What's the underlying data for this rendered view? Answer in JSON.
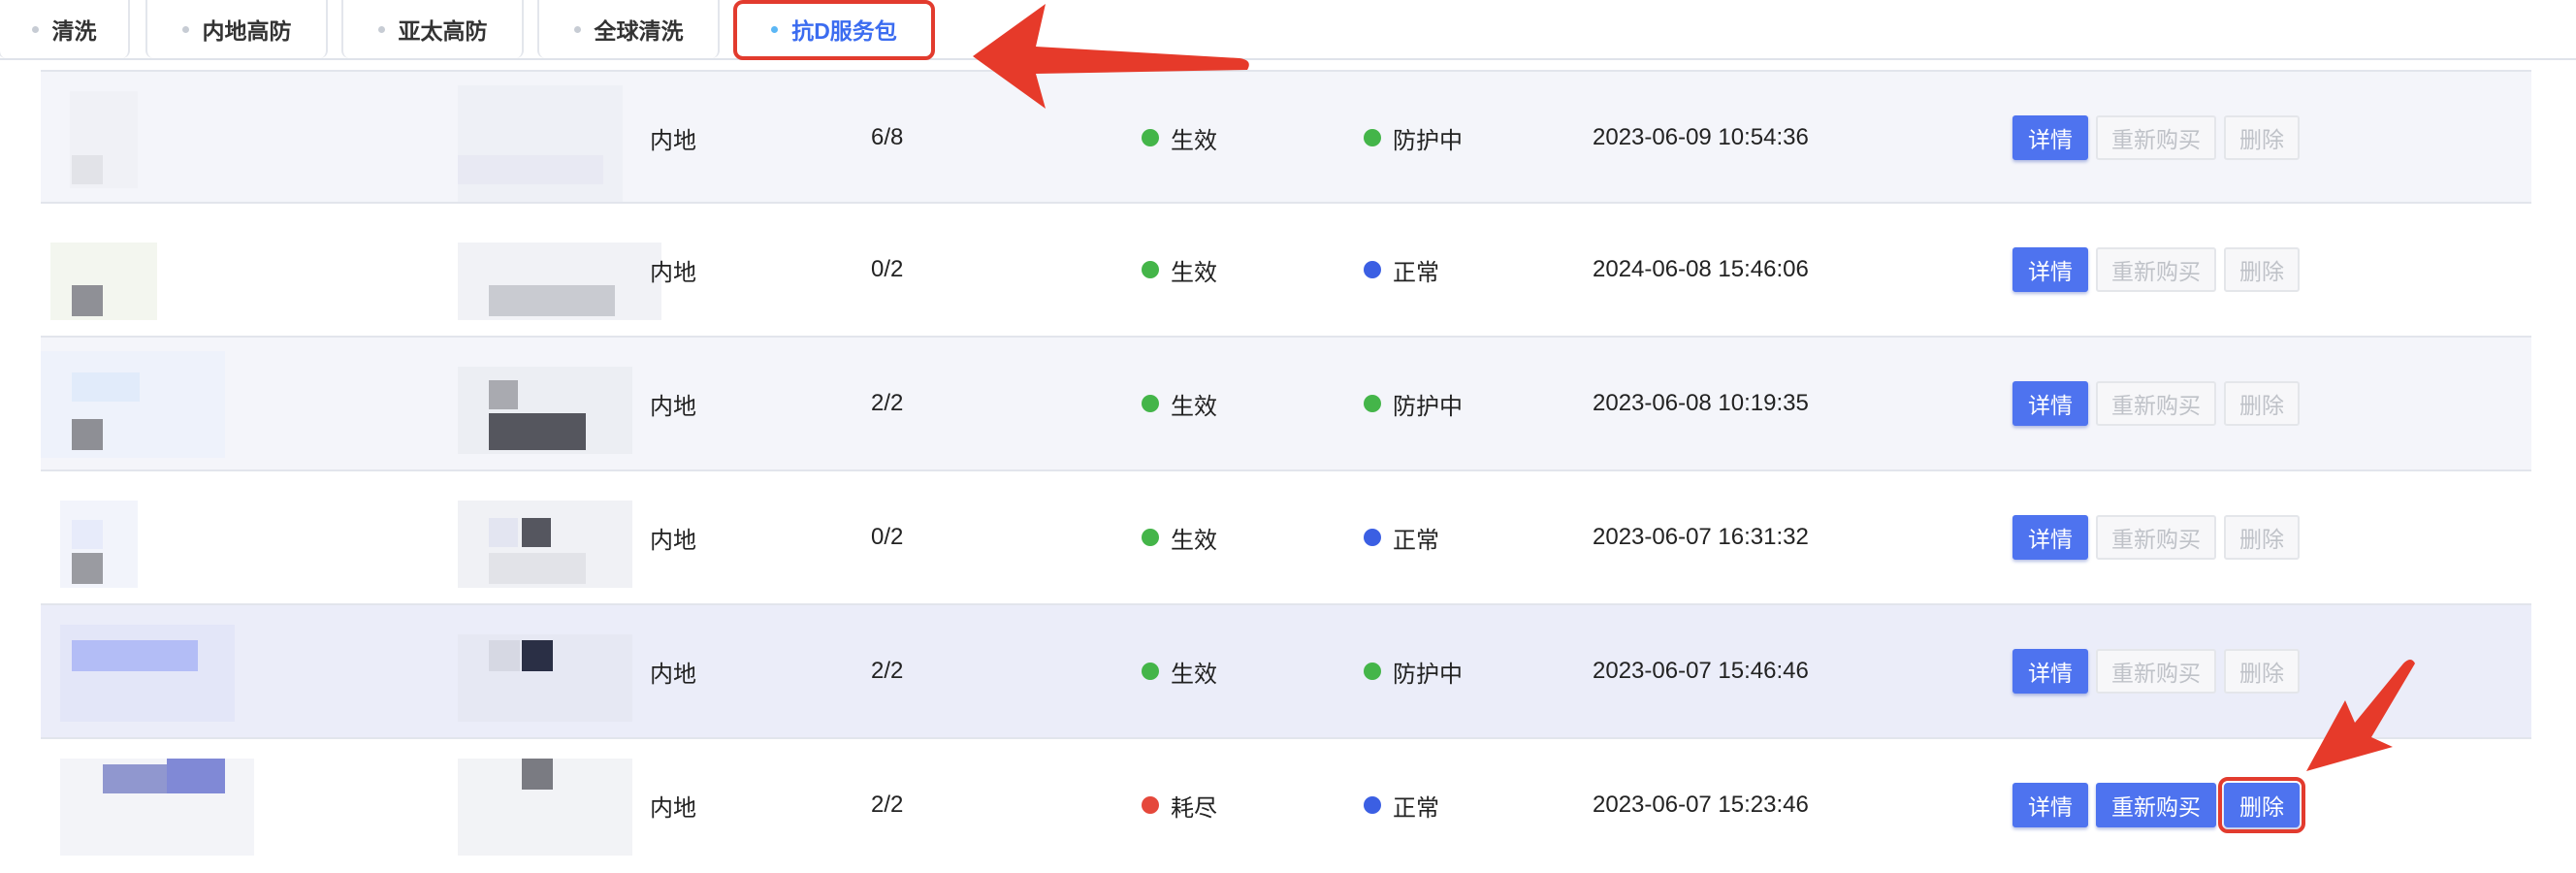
{
  "tabs": [
    {
      "label": "清洗",
      "active": false
    },
    {
      "label": "内地高防",
      "active": false
    },
    {
      "label": "亚太高防",
      "active": false
    },
    {
      "label": "全球清洗",
      "active": false
    },
    {
      "label": "抗D服务包",
      "active": true
    }
  ],
  "rows": [
    {
      "region": "内地",
      "usage": "6/8",
      "status": "生效",
      "status_color": "#44b549",
      "protection": "防护中",
      "protection_color": "#44b549",
      "time": "2023-06-09 10:54:36"
    },
    {
      "region": "内地",
      "usage": "0/2",
      "status": "生效",
      "status_color": "#44b549",
      "protection": "正常",
      "protection_color": "#3b5fe3",
      "time": "2024-06-08 15:46:06"
    },
    {
      "region": "内地",
      "usage": "2/2",
      "status": "生效",
      "status_color": "#44b549",
      "protection": "防护中",
      "protection_color": "#44b549",
      "time": "2023-06-08 10:19:35"
    },
    {
      "region": "内地",
      "usage": "0/2",
      "status": "生效",
      "status_color": "#44b549",
      "protection": "正常",
      "protection_color": "#3b5fe3",
      "time": "2023-06-07 16:31:32"
    },
    {
      "region": "内地",
      "usage": "2/2",
      "status": "生效",
      "status_color": "#44b549",
      "protection": "防护中",
      "protection_color": "#44b549",
      "time": "2023-06-07 15:46:46"
    },
    {
      "region": "内地",
      "usage": "2/2",
      "status": "耗尽",
      "status_color": "#e5483b",
      "protection": "正常",
      "protection_color": "#3b5fe3",
      "time": "2023-06-07 15:23:46"
    }
  ],
  "actions": {
    "detail": "详情",
    "rebuy": "重新购买",
    "delete": "删除"
  },
  "colors": {
    "accent": "#4e73ef",
    "highlight": "#e23b2e"
  }
}
